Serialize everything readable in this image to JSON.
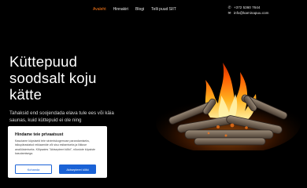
{
  "nav": {
    "items": [
      "Avaleht",
      "Hinnakiri",
      "Blogi",
      "Telli puud SIIT"
    ],
    "active_color": "#ff7a1a"
  },
  "contact": {
    "phone_icon": "phone-icon",
    "phone": "+372 5360 7644",
    "email_icon": "mail-icon",
    "email": "info@kaminapuu.com"
  },
  "hero": {
    "title": "Küttepuud soodsalt koju kätte",
    "text": "Tahaksid end soojendada elava tule ees või käia saunas, kuid küttepuid ei ole ning"
  },
  "cookie": {
    "title": "Hindame teie privaatsust",
    "text": "Kasutame küpsiseid teie sirvimiskogemuse parandamiseks, isikupärastatud reklaamide või sisu esitamiseks ja liikluse analüüsimiseks. Klõpsates \"Aktsepteeri kõiki\", nõustute küpsiste kasutamisega.",
    "customize_label": "Kohanda",
    "accept_label": "Aktsepteeri kõiki",
    "button_color": "#1a62d6"
  }
}
